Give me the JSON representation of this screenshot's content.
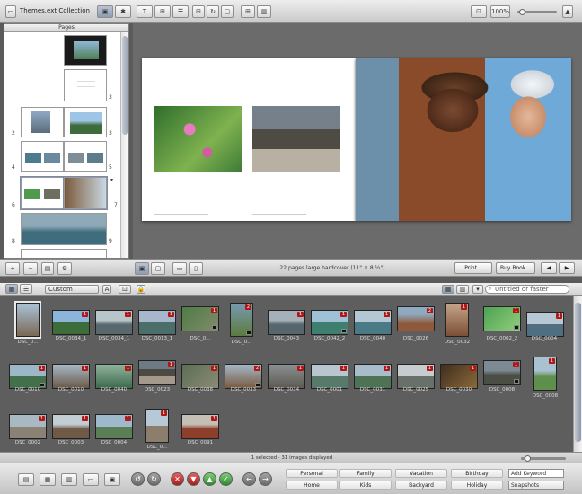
{
  "app": {
    "title": "Themes.ext Collection"
  },
  "toolbar": {
    "zoom_label": "100%",
    "text_tool": "T",
    "layout_tool": "⊞",
    "arrange_tool": "☰"
  },
  "pages_panel": {
    "header": "Pages",
    "page_numbers": [
      "3",
      "2",
      "3",
      "4",
      "5",
      "6",
      "7",
      "8",
      "9"
    ]
  },
  "book": {
    "status": "22 pages large hardcover (11\" × 8 ½\")",
    "print_button": "Print...",
    "buy_button": "Buy Book...",
    "prev_icon": "◀",
    "next_icon": "▶"
  },
  "browser": {
    "sort_select": "Custom",
    "search_placeholder": "Untitled or faster",
    "photos": [
      {
        "label": "DSC_0...",
        "badge": ""
      },
      {
        "label": "DSC_0034_1",
        "badge": "1"
      },
      {
        "label": "DSC_0034_1",
        "badge": "1"
      },
      {
        "label": "DSC_0013_1",
        "badge": "1"
      },
      {
        "label": "DSC_0...",
        "badge": "1"
      },
      {
        "label": "DSC_0...",
        "badge": "2"
      },
      {
        "label": "DSC_0043",
        "badge": "1"
      },
      {
        "label": "DSC_0042_2",
        "badge": "1"
      },
      {
        "label": "DSC_0040",
        "badge": "1"
      },
      {
        "label": "DSC_0026",
        "badge": "2"
      },
      {
        "label": "DSC_0032",
        "badge": "1"
      },
      {
        "label": "DSC_0002_2",
        "badge": "1"
      },
      {
        "label": "DSC_0004",
        "badge": "1"
      },
      {
        "label": "DSC_0010",
        "badge": "1"
      },
      {
        "label": "DSC_0010",
        "badge": "1"
      },
      {
        "label": "DSC_0040",
        "badge": "1"
      },
      {
        "label": "DSC_0023",
        "badge": "1"
      },
      {
        "label": "DSC_0038",
        "badge": "1"
      },
      {
        "label": "DSC_0033",
        "badge": "2"
      },
      {
        "label": "DSC_0034",
        "badge": "1"
      },
      {
        "label": "DSC_0001",
        "badge": "1"
      },
      {
        "label": "DSC_0031",
        "badge": "1"
      },
      {
        "label": "DSC_0025",
        "badge": "1"
      },
      {
        "label": "DSC_0030",
        "badge": "1"
      },
      {
        "label": "DSC_0008",
        "badge": "1"
      },
      {
        "label": "DSC_0008",
        "badge": "1"
      },
      {
        "label": "DSC_0002",
        "badge": "1"
      },
      {
        "label": "DSC_0003",
        "badge": "1"
      },
      {
        "label": "DSC_0004",
        "badge": "1"
      },
      {
        "label": "DSC_0...",
        "badge": "1"
      },
      {
        "label": "DSC_0091",
        "badge": "1"
      }
    ],
    "status": "1 selected · 31 images displayed"
  },
  "keywords": {
    "row1": [
      "Personal",
      "Family",
      "Vacation",
      "Birthday"
    ],
    "row2": [
      "Home",
      "Kids",
      "Backyard",
      "Holiday"
    ],
    "input_value": "Add Keyword",
    "select_value": "Snapshots"
  },
  "colors": {
    "badge": "#b01818",
    "selection": "#7a8aa8",
    "canvas": "#6b6b6b"
  }
}
